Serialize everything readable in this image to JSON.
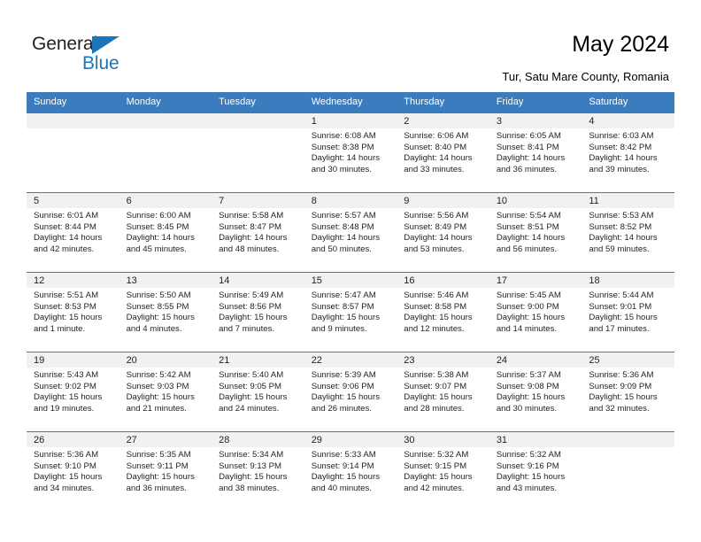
{
  "brand": {
    "name_part1": "General",
    "name_part2": "Blue",
    "triangle_color": "#1b75bb",
    "text_color": "#231f20"
  },
  "header": {
    "title": "May 2024",
    "subtitle": "Tur, Satu Mare County, Romania",
    "accent_color": "#3b7cbe",
    "band_color": "#f1f1f1"
  },
  "calendar": {
    "weekday_headers": [
      "Sunday",
      "Monday",
      "Tuesday",
      "Wednesday",
      "Thursday",
      "Friday",
      "Saturday"
    ],
    "labels": {
      "sunrise": "Sunrise:",
      "sunset": "Sunset:",
      "daylight": "Daylight:"
    },
    "weeks": [
      [
        {
          "day": "",
          "empty": true
        },
        {
          "day": "",
          "empty": true
        },
        {
          "day": "",
          "empty": true
        },
        {
          "day": "1",
          "sunrise": "Sunrise: 6:08 AM",
          "sunset": "Sunset: 8:38 PM",
          "daylight_1": "Daylight: 14 hours",
          "daylight_2": "and 30 minutes."
        },
        {
          "day": "2",
          "sunrise": "Sunrise: 6:06 AM",
          "sunset": "Sunset: 8:40 PM",
          "daylight_1": "Daylight: 14 hours",
          "daylight_2": "and 33 minutes."
        },
        {
          "day": "3",
          "sunrise": "Sunrise: 6:05 AM",
          "sunset": "Sunset: 8:41 PM",
          "daylight_1": "Daylight: 14 hours",
          "daylight_2": "and 36 minutes."
        },
        {
          "day": "4",
          "sunrise": "Sunrise: 6:03 AM",
          "sunset": "Sunset: 8:42 PM",
          "daylight_1": "Daylight: 14 hours",
          "daylight_2": "and 39 minutes."
        }
      ],
      [
        {
          "day": "5",
          "sunrise": "Sunrise: 6:01 AM",
          "sunset": "Sunset: 8:44 PM",
          "daylight_1": "Daylight: 14 hours",
          "daylight_2": "and 42 minutes."
        },
        {
          "day": "6",
          "sunrise": "Sunrise: 6:00 AM",
          "sunset": "Sunset: 8:45 PM",
          "daylight_1": "Daylight: 14 hours",
          "daylight_2": "and 45 minutes."
        },
        {
          "day": "7",
          "sunrise": "Sunrise: 5:58 AM",
          "sunset": "Sunset: 8:47 PM",
          "daylight_1": "Daylight: 14 hours",
          "daylight_2": "and 48 minutes."
        },
        {
          "day": "8",
          "sunrise": "Sunrise: 5:57 AM",
          "sunset": "Sunset: 8:48 PM",
          "daylight_1": "Daylight: 14 hours",
          "daylight_2": "and 50 minutes."
        },
        {
          "day": "9",
          "sunrise": "Sunrise: 5:56 AM",
          "sunset": "Sunset: 8:49 PM",
          "daylight_1": "Daylight: 14 hours",
          "daylight_2": "and 53 minutes."
        },
        {
          "day": "10",
          "sunrise": "Sunrise: 5:54 AM",
          "sunset": "Sunset: 8:51 PM",
          "daylight_1": "Daylight: 14 hours",
          "daylight_2": "and 56 minutes."
        },
        {
          "day": "11",
          "sunrise": "Sunrise: 5:53 AM",
          "sunset": "Sunset: 8:52 PM",
          "daylight_1": "Daylight: 14 hours",
          "daylight_2": "and 59 minutes."
        }
      ],
      [
        {
          "day": "12",
          "sunrise": "Sunrise: 5:51 AM",
          "sunset": "Sunset: 8:53 PM",
          "daylight_1": "Daylight: 15 hours",
          "daylight_2": "and 1 minute."
        },
        {
          "day": "13",
          "sunrise": "Sunrise: 5:50 AM",
          "sunset": "Sunset: 8:55 PM",
          "daylight_1": "Daylight: 15 hours",
          "daylight_2": "and 4 minutes."
        },
        {
          "day": "14",
          "sunrise": "Sunrise: 5:49 AM",
          "sunset": "Sunset: 8:56 PM",
          "daylight_1": "Daylight: 15 hours",
          "daylight_2": "and 7 minutes."
        },
        {
          "day": "15",
          "sunrise": "Sunrise: 5:47 AM",
          "sunset": "Sunset: 8:57 PM",
          "daylight_1": "Daylight: 15 hours",
          "daylight_2": "and 9 minutes."
        },
        {
          "day": "16",
          "sunrise": "Sunrise: 5:46 AM",
          "sunset": "Sunset: 8:58 PM",
          "daylight_1": "Daylight: 15 hours",
          "daylight_2": "and 12 minutes."
        },
        {
          "day": "17",
          "sunrise": "Sunrise: 5:45 AM",
          "sunset": "Sunset: 9:00 PM",
          "daylight_1": "Daylight: 15 hours",
          "daylight_2": "and 14 minutes."
        },
        {
          "day": "18",
          "sunrise": "Sunrise: 5:44 AM",
          "sunset": "Sunset: 9:01 PM",
          "daylight_1": "Daylight: 15 hours",
          "daylight_2": "and 17 minutes."
        }
      ],
      [
        {
          "day": "19",
          "sunrise": "Sunrise: 5:43 AM",
          "sunset": "Sunset: 9:02 PM",
          "daylight_1": "Daylight: 15 hours",
          "daylight_2": "and 19 minutes."
        },
        {
          "day": "20",
          "sunrise": "Sunrise: 5:42 AM",
          "sunset": "Sunset: 9:03 PM",
          "daylight_1": "Daylight: 15 hours",
          "daylight_2": "and 21 minutes."
        },
        {
          "day": "21",
          "sunrise": "Sunrise: 5:40 AM",
          "sunset": "Sunset: 9:05 PM",
          "daylight_1": "Daylight: 15 hours",
          "daylight_2": "and 24 minutes."
        },
        {
          "day": "22",
          "sunrise": "Sunrise: 5:39 AM",
          "sunset": "Sunset: 9:06 PM",
          "daylight_1": "Daylight: 15 hours",
          "daylight_2": "and 26 minutes."
        },
        {
          "day": "23",
          "sunrise": "Sunrise: 5:38 AM",
          "sunset": "Sunset: 9:07 PM",
          "daylight_1": "Daylight: 15 hours",
          "daylight_2": "and 28 minutes."
        },
        {
          "day": "24",
          "sunrise": "Sunrise: 5:37 AM",
          "sunset": "Sunset: 9:08 PM",
          "daylight_1": "Daylight: 15 hours",
          "daylight_2": "and 30 minutes."
        },
        {
          "day": "25",
          "sunrise": "Sunrise: 5:36 AM",
          "sunset": "Sunset: 9:09 PM",
          "daylight_1": "Daylight: 15 hours",
          "daylight_2": "and 32 minutes."
        }
      ],
      [
        {
          "day": "26",
          "sunrise": "Sunrise: 5:36 AM",
          "sunset": "Sunset: 9:10 PM",
          "daylight_1": "Daylight: 15 hours",
          "daylight_2": "and 34 minutes."
        },
        {
          "day": "27",
          "sunrise": "Sunrise: 5:35 AM",
          "sunset": "Sunset: 9:11 PM",
          "daylight_1": "Daylight: 15 hours",
          "daylight_2": "and 36 minutes."
        },
        {
          "day": "28",
          "sunrise": "Sunrise: 5:34 AM",
          "sunset": "Sunset: 9:13 PM",
          "daylight_1": "Daylight: 15 hours",
          "daylight_2": "and 38 minutes."
        },
        {
          "day": "29",
          "sunrise": "Sunrise: 5:33 AM",
          "sunset": "Sunset: 9:14 PM",
          "daylight_1": "Daylight: 15 hours",
          "daylight_2": "and 40 minutes."
        },
        {
          "day": "30",
          "sunrise": "Sunrise: 5:32 AM",
          "sunset": "Sunset: 9:15 PM",
          "daylight_1": "Daylight: 15 hours",
          "daylight_2": "and 42 minutes."
        },
        {
          "day": "31",
          "sunrise": "Sunrise: 5:32 AM",
          "sunset": "Sunset: 9:16 PM",
          "daylight_1": "Daylight: 15 hours",
          "daylight_2": "and 43 minutes."
        },
        {
          "day": "",
          "empty": true
        }
      ]
    ]
  }
}
